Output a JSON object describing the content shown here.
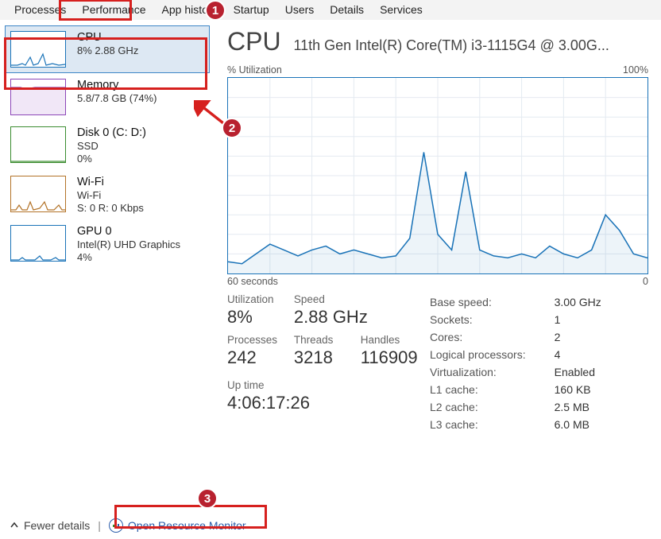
{
  "tabs": [
    "Processes",
    "Performance",
    "App history",
    "Startup",
    "Users",
    "Details",
    "Services"
  ],
  "active_tab": "Performance",
  "sidebar": {
    "items": [
      {
        "title": "CPU",
        "sub": "8%  2.88 GHz"
      },
      {
        "title": "Memory",
        "sub": "5.8/7.8 GB (74%)"
      },
      {
        "title": "Disk 0 (C: D:)",
        "sub1": "SSD",
        "sub2": "0%"
      },
      {
        "title": "Wi-Fi",
        "sub1": "Wi-Fi",
        "sub2": "S: 0 R: 0 Kbps"
      },
      {
        "title": "GPU 0",
        "sub1": "Intel(R) UHD Graphics",
        "sub2": "4%"
      }
    ]
  },
  "panel": {
    "title": "CPU",
    "subtitle": "11th Gen Intel(R) Core(TM) i3-1115G4 @ 3.00G...",
    "chart_top_left": "% Utilization",
    "chart_top_right": "100%",
    "chart_bottom_left": "60 seconds",
    "chart_bottom_right": "0",
    "stats": {
      "utilization": {
        "label": "Utilization",
        "value": "8%"
      },
      "speed": {
        "label": "Speed",
        "value": "2.88 GHz"
      },
      "processes": {
        "label": "Processes",
        "value": "242"
      },
      "threads": {
        "label": "Threads",
        "value": "3218"
      },
      "handles": {
        "label": "Handles",
        "value": "116909"
      },
      "uptime": {
        "label": "Up time",
        "value": "4:06:17:26"
      }
    },
    "specs": [
      {
        "k": "Base speed:",
        "v": "3.00 GHz"
      },
      {
        "k": "Sockets:",
        "v": "1"
      },
      {
        "k": "Cores:",
        "v": "2"
      },
      {
        "k": "Logical processors:",
        "v": "4"
      },
      {
        "k": "Virtualization:",
        "v": "Enabled"
      },
      {
        "k": "L1 cache:",
        "v": "160 KB"
      },
      {
        "k": "L2 cache:",
        "v": "2.5 MB"
      },
      {
        "k": "L3 cache:",
        "v": "6.0 MB"
      }
    ]
  },
  "footer": {
    "fewer": "Fewer details",
    "reslink": "Open Resource Monitor"
  },
  "chart_data": {
    "type": "line",
    "title": "% Utilization",
    "xlabel": "60 seconds",
    "ylabel": "",
    "ylim": [
      0,
      100
    ],
    "x_seconds_ago": [
      60,
      58,
      56,
      54,
      52,
      50,
      48,
      46,
      44,
      42,
      40,
      38,
      36,
      34,
      32,
      30,
      28,
      26,
      24,
      22,
      20,
      18,
      16,
      14,
      12,
      10,
      8,
      6,
      4,
      2,
      0
    ],
    "values": [
      6,
      5,
      10,
      15,
      12,
      9,
      12,
      14,
      10,
      12,
      10,
      8,
      9,
      18,
      62,
      20,
      12,
      52,
      12,
      9,
      8,
      10,
      8,
      14,
      10,
      8,
      12,
      30,
      22,
      10,
      8
    ]
  },
  "annotations": {
    "badges": [
      "1",
      "2",
      "3"
    ]
  }
}
